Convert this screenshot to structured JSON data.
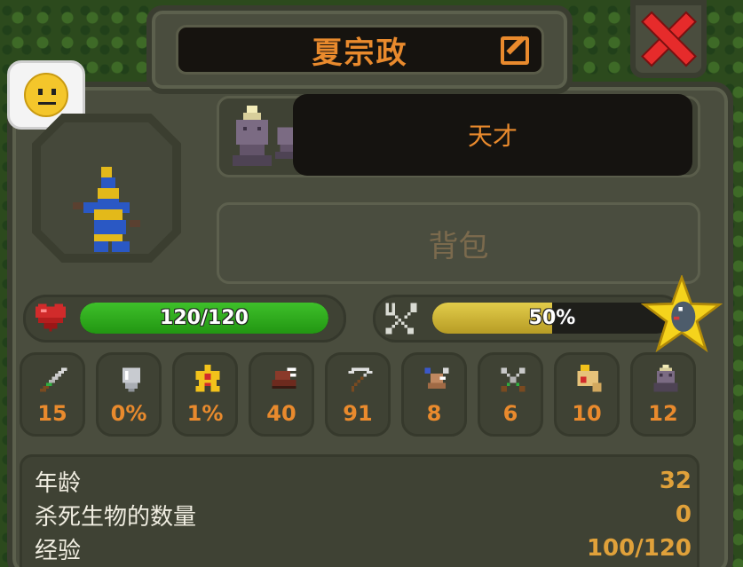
{
  "character": {
    "name": "夏宗政",
    "trait": "天才"
  },
  "inventory": {
    "backpack_label": "背包"
  },
  "health": {
    "text": "120/120",
    "current": 120,
    "max": 120
  },
  "hunger": {
    "text": "50%",
    "percent": 50
  },
  "stats": [
    {
      "icon": "sword-icon",
      "value": "15"
    },
    {
      "icon": "shield-icon",
      "value": "0%"
    },
    {
      "icon": "critical-star-icon",
      "value": "1%"
    },
    {
      "icon": "boot-speed-icon",
      "value": "40"
    },
    {
      "icon": "scythe-icon",
      "value": "91"
    },
    {
      "icon": "pickaxe-icon",
      "value": "8"
    },
    {
      "icon": "crossed-swords-icon",
      "value": "6"
    },
    {
      "icon": "scroll-icon",
      "value": "10"
    },
    {
      "icon": "totem-icon",
      "value": "12"
    }
  ],
  "info": [
    {
      "label": "年龄",
      "value": "32"
    },
    {
      "label": "杀死生物的数量",
      "value": "0"
    },
    {
      "label": "经验",
      "value": "100/120"
    }
  ],
  "colors": {
    "accent": "#e98a2d",
    "health": "#3ec02a",
    "hunger": "#e2cc4a",
    "close": "#e62b2b"
  }
}
